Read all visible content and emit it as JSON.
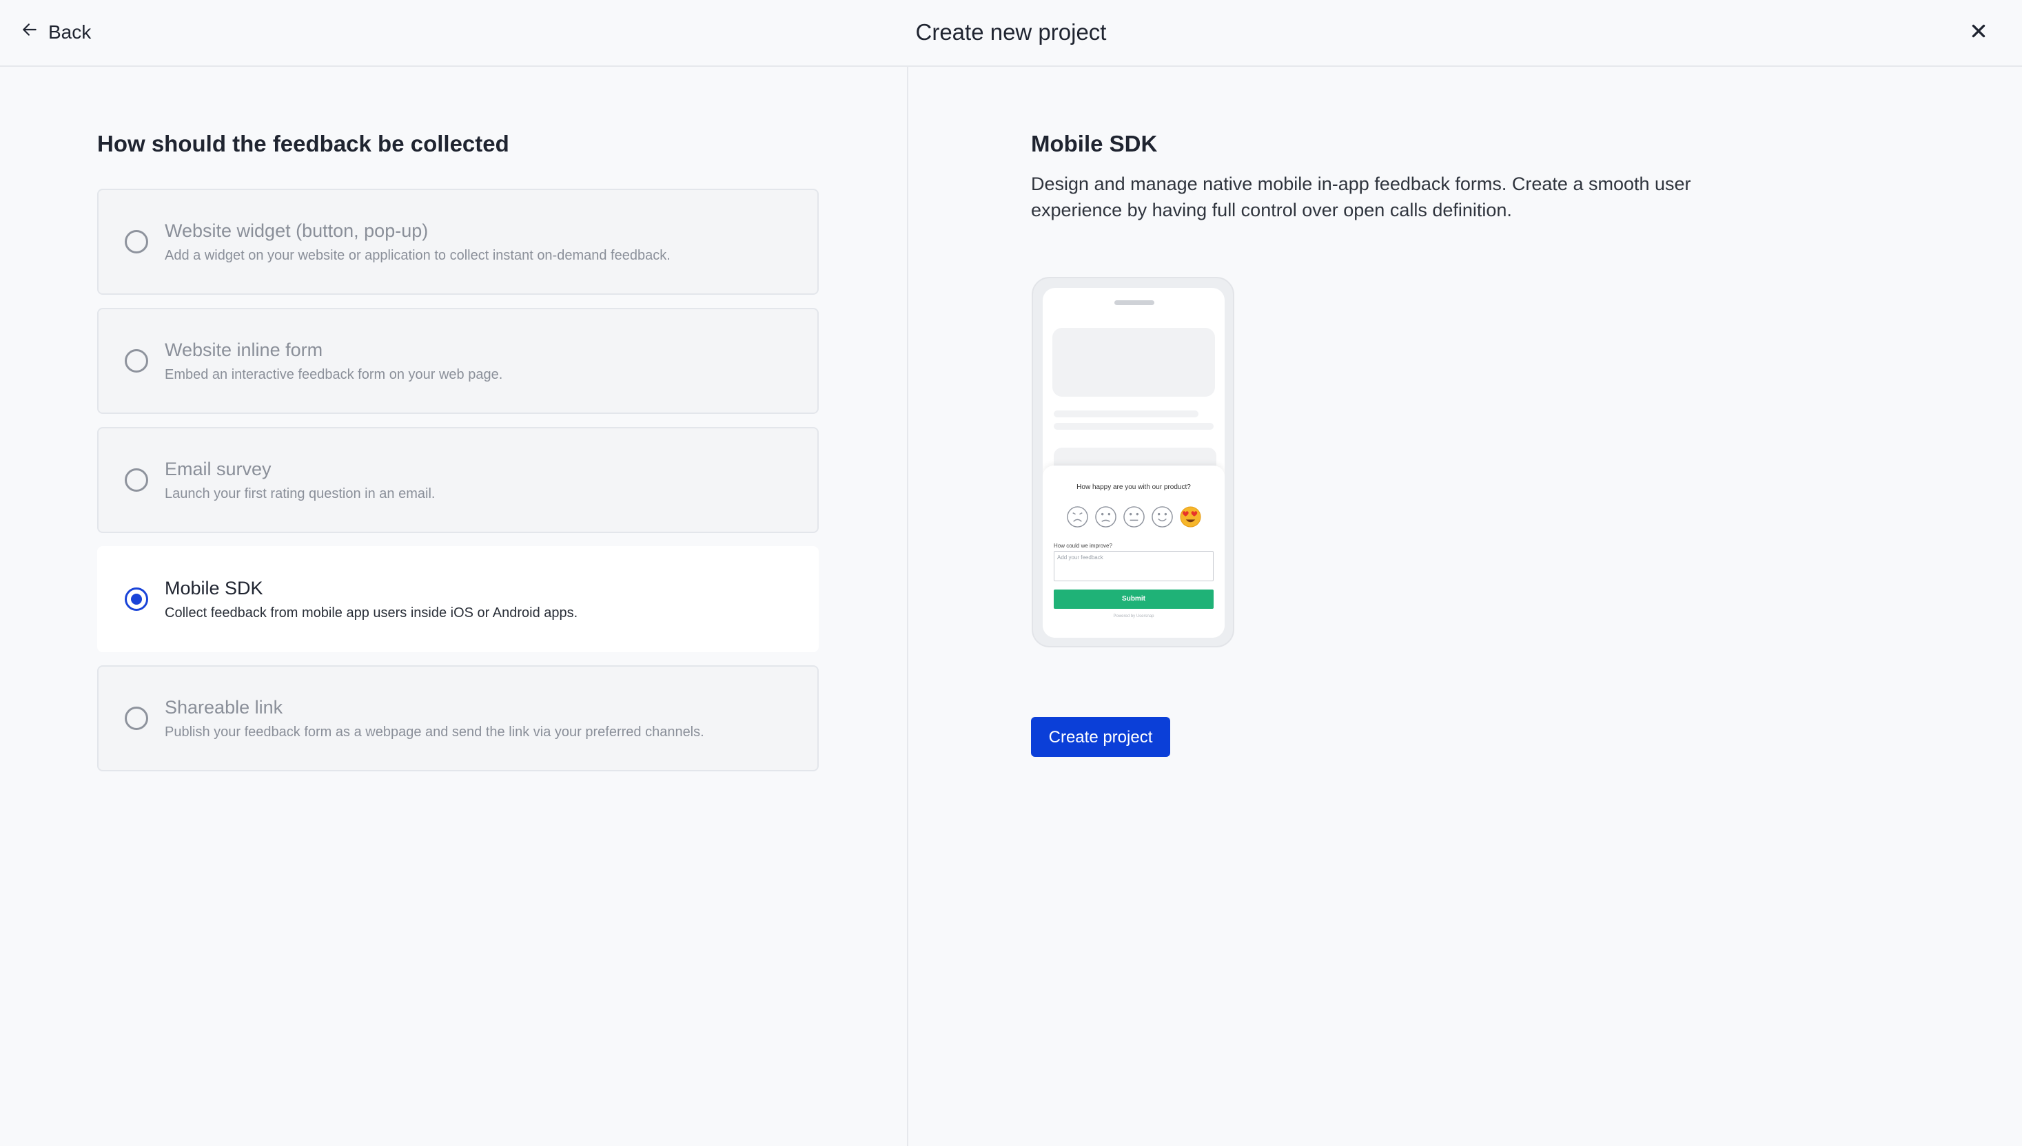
{
  "header": {
    "back_label": "Back",
    "title": "Create new project",
    "close_icon": "close-icon",
    "back_icon": "arrow-left-icon"
  },
  "left": {
    "title": "How should the feedback be collected",
    "options": [
      {
        "title": "Website widget (button, pop-up)",
        "description": "Add a widget on your website or application to collect instant on-demand feedback.",
        "selected": false
      },
      {
        "title": "Website inline form",
        "description": "Embed an interactive feedback form on your web page.",
        "selected": false
      },
      {
        "title": "Email survey",
        "description": "Launch your first rating question in an email.",
        "selected": false
      },
      {
        "title": "Mobile SDK",
        "description": "Collect feedback from mobile app users inside iOS or Android apps.",
        "selected": true
      },
      {
        "title": "Shareable link",
        "description": "Publish your feedback form as a webpage and send the link via your preferred channels.",
        "selected": false
      }
    ]
  },
  "right": {
    "title": "Mobile SDK",
    "description": "Design and manage native mobile in-app feedback forms. Create a smooth user experience by having full control over open calls definition.",
    "preview": {
      "question": "How happy are you with our product?",
      "improve_label": "How could we improve?",
      "input_placeholder": "Add your feedback",
      "submit_label": "Submit",
      "powered_by": "Powered by Usersnap"
    },
    "create_button_label": "Create project"
  },
  "colors": {
    "accent": "#0b3fd8",
    "radio_selected": "#1a44d8",
    "submit_green": "#1fb277"
  }
}
